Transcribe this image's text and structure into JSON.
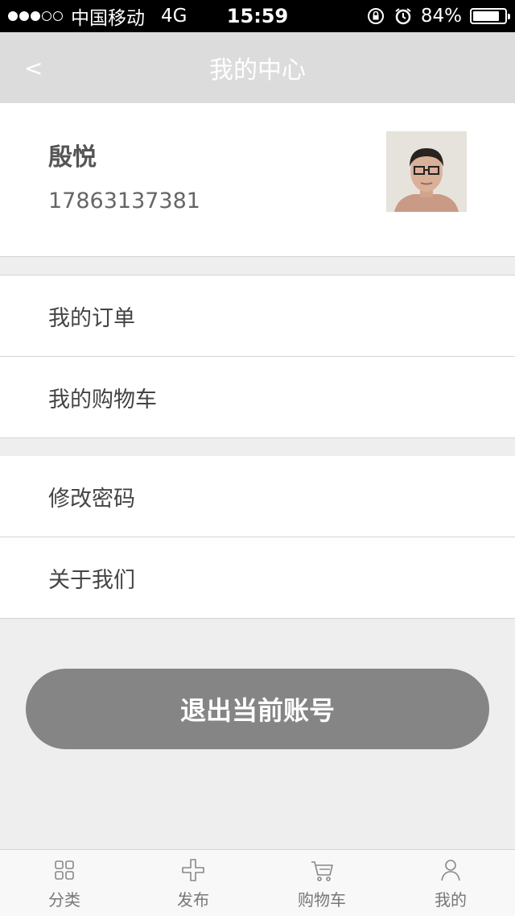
{
  "status_bar": {
    "carrier": "中国移动",
    "network": "4G",
    "time": "15:59",
    "battery": "84%",
    "battery_level": 0.84,
    "signal_bars": 3
  },
  "nav": {
    "back_label": "<",
    "title": "我的中心"
  },
  "profile": {
    "name": "殷悦",
    "phone": "17863137381"
  },
  "menu": {
    "orders": "我的订单",
    "cart": "我的购物车",
    "change_password": "修改密码",
    "about": "关于我们"
  },
  "logout_label": "退出当前账号",
  "tabs": [
    {
      "label": "分类",
      "icon": "grid-icon"
    },
    {
      "label": "发布",
      "icon": "plus-icon"
    },
    {
      "label": "购物车",
      "icon": "cart-icon"
    },
    {
      "label": "我的",
      "icon": "person-icon"
    }
  ],
  "colors": {
    "nav_bg": "#dcdcdc",
    "logout_bg": "#858585",
    "page_bg": "#eeeeee"
  }
}
